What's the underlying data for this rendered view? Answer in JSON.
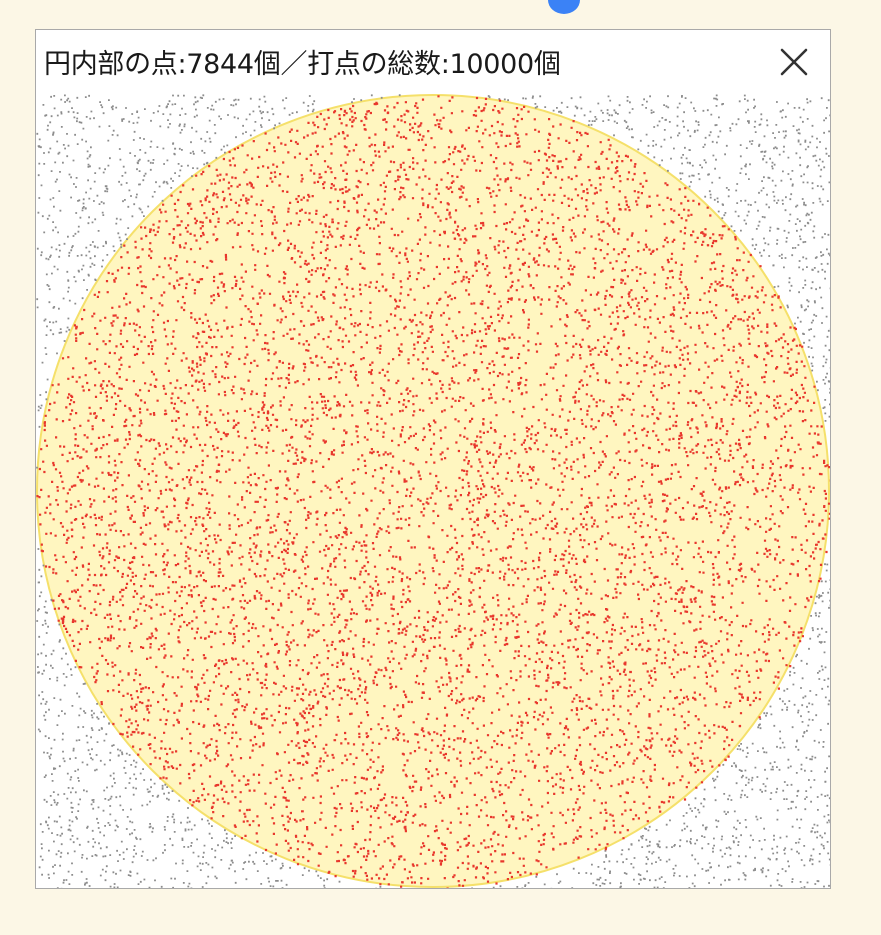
{
  "window": {
    "title": "円内部の点:7844個／打点の総数:10000個",
    "close_icon": "close-icon"
  },
  "simulation": {
    "inside_count": 7844,
    "total_count": 10000,
    "outside_dot_color": "#8c8c8c",
    "inside_dot_color": "#e8372c",
    "circle_fill": "#fff6c0",
    "circle_stroke": "#f5e06a"
  },
  "colors": {
    "page_background": "#fcf7e6",
    "accent_dot": "#3b82f6"
  }
}
